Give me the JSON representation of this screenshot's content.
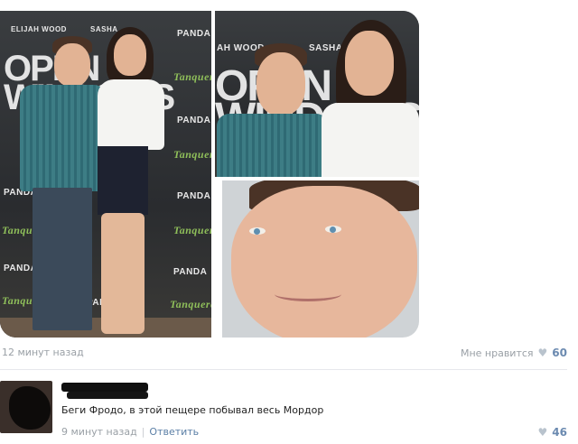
{
  "post": {
    "photos": {
      "left": {
        "sponsor_top_1": "ELIJAH WOOD",
        "sponsor_top_2": "SASHA",
        "brand_panda": "PANDA",
        "brand_tanqueray": "Tanqueray",
        "big_title": "OPEN\nWINDOWS"
      },
      "top_right": {
        "sponsor_top_1": "AH WOOD",
        "sponsor_top_2": "SASHA",
        "big_title": "OPEN\nWINDOWS"
      }
    },
    "time": "12 минут назад",
    "like_label": "Мне нравится",
    "like_count": "60"
  },
  "comment": {
    "text": "Беги Фродо, в этой пещере побывал весь Мордор",
    "time": "9 минут назад",
    "reply_label": "Ответить",
    "like_count": "46"
  },
  "icons": {
    "heart": "heart-icon"
  },
  "colors": {
    "link": "#5b7fa6",
    "like_count": "#6b8ab0",
    "meta": "#9aa0a6"
  }
}
